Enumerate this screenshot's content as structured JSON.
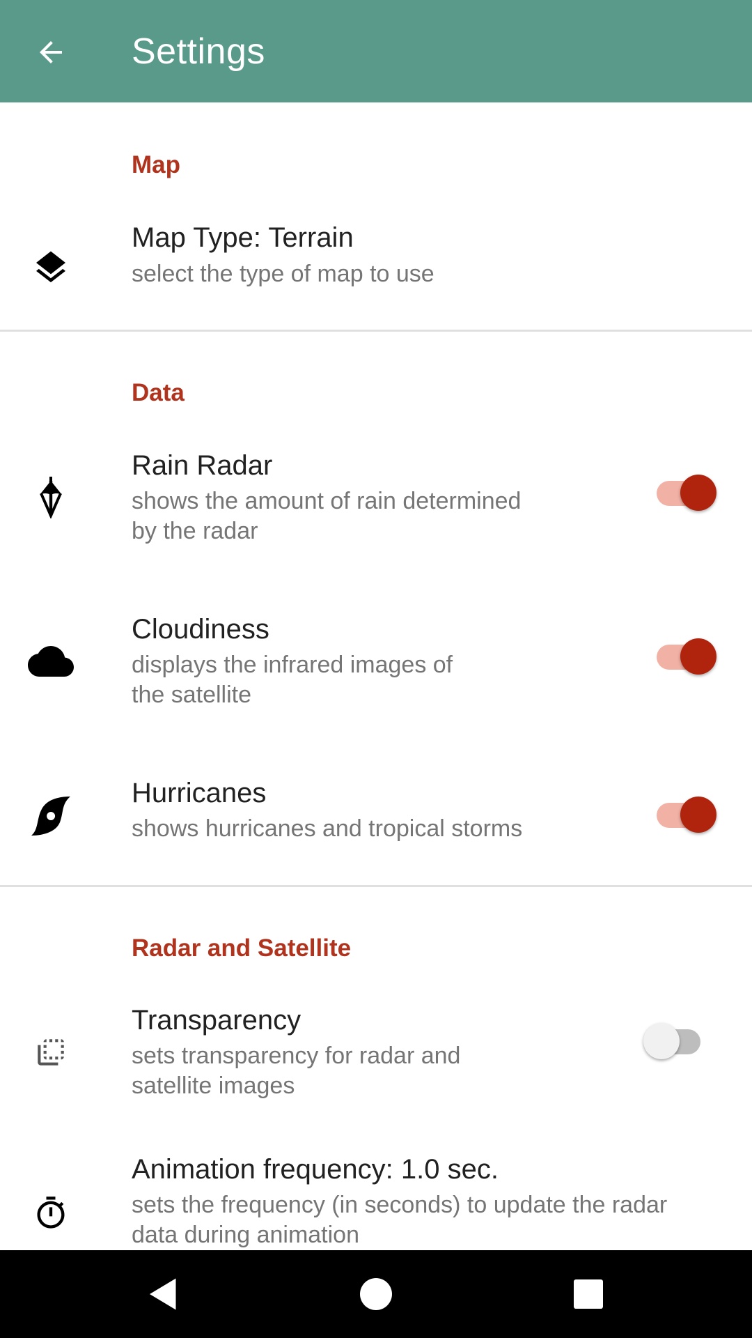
{
  "appbar": {
    "title": "Settings",
    "back_icon": "arrow-left-icon",
    "color": "#5a9a8b"
  },
  "sections": {
    "map": {
      "header": "Map",
      "map_type": {
        "title": "Map Type: Terrain",
        "summary": "select the type of map to use",
        "icon": "layers-icon"
      }
    },
    "data": {
      "header": "Data",
      "rain_radar": {
        "title": "Rain Radar",
        "summary_line1": "shows the amount of rain determined",
        "summary_line2": "by the radar",
        "icon": "umbrella-icon",
        "enabled": true
      },
      "cloudiness": {
        "title": "Cloudiness",
        "summary_line1": "displays the infrared images of",
        "summary_line2": "the satellite",
        "icon": "cloud-icon",
        "enabled": true
      },
      "hurricanes": {
        "title": "Hurricanes",
        "summary": "shows hurricanes and tropical storms",
        "icon": "hurricane-icon",
        "enabled": true
      }
    },
    "radar_satellite": {
      "header": "Radar and Satellite",
      "transparency": {
        "title": "Transparency",
        "summary_line1": "sets transparency for radar and",
        "summary_line2": "satellite images",
        "icon": "flip-to-back-icon",
        "enabled": false
      },
      "animation": {
        "title": "Animation frequency: 1.0 sec.",
        "summary_line1": "sets the frequency (in seconds) to update the radar",
        "summary_line2": "data during animation",
        "icon": "timer-icon"
      }
    }
  },
  "colors": {
    "accent": "#b0331d",
    "switch_on_thumb": "#b0240e",
    "switch_on_track": "#f2b1a5"
  },
  "navbar": {
    "back": "nav-back-icon",
    "home": "nav-home-icon",
    "recents": "nav-recents-icon"
  }
}
